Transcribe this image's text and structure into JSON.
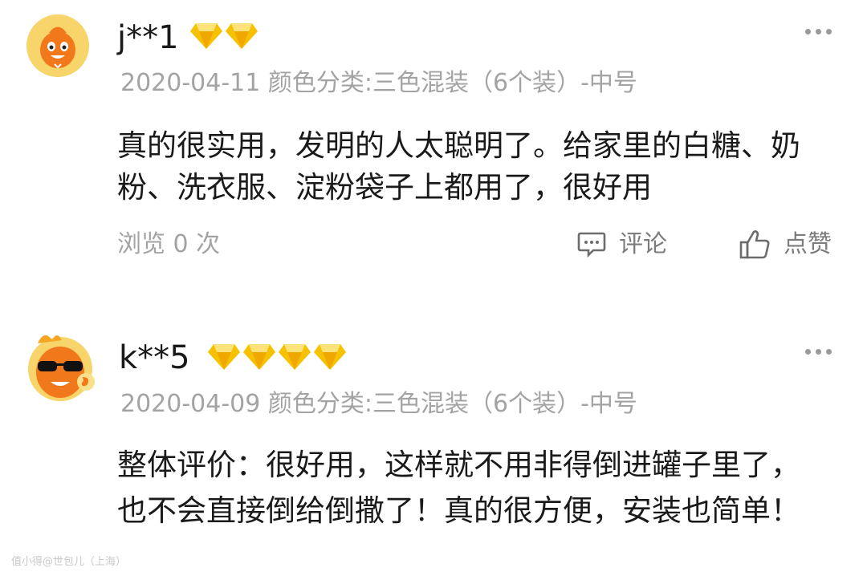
{
  "reviews": [
    {
      "username": "j**1",
      "badge_count": 2,
      "avatar": "orange-mascot-smiling",
      "meta": "2020-04-11 颜色分类:三色混装（6个装）-中号",
      "text": "真的很实用，发明的人太聪明了。给家里的白糖、奶粉、洗衣服、淀粉袋子上都用了，很好用",
      "views": "浏览 0 次",
      "comment_label": "评论",
      "like_label": "点赞"
    },
    {
      "username": "k**5",
      "badge_count": 4,
      "avatar": "orange-mascot-sunglasses",
      "meta": "2020-04-09 颜色分类:三色混装（6个装）-中号",
      "text": "整体评价：很好用，这样就不用非得倒进罐子里了，也不会直接倒给倒撒了！真的很方便，安装也简单！"
    }
  ],
  "watermark": "值小得@世包儿（上海）",
  "colors": {
    "badge_gold": "#f6c200",
    "meta_gray": "#a3a3a3",
    "avatar_bg": "#f7d56a",
    "mascot_orange": "#f2781c"
  }
}
